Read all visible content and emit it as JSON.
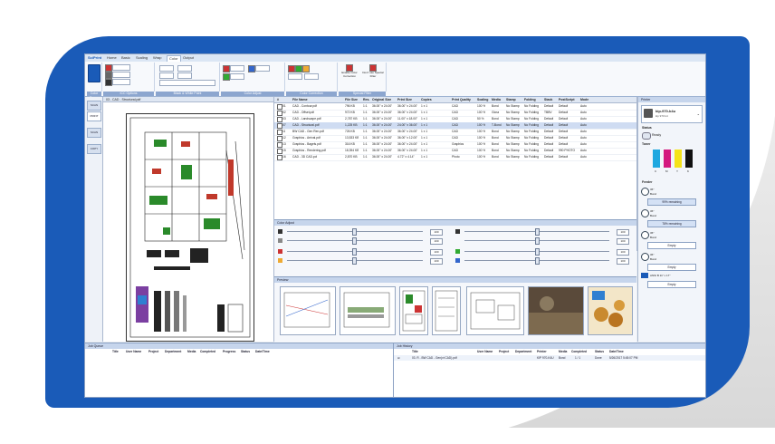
{
  "ribbon": {
    "tabs": [
      "SciPrint",
      "Home",
      "Basic",
      "Scaling",
      "Wrap",
      "Color",
      "Output"
    ],
    "groups": [
      "Color Space",
      "ICC Options",
      "Black & White Point",
      "Color Adjust",
      "Color Correction",
      "Special Filter"
    ],
    "actions": [
      "Enable Color Correction",
      "Don't use Special Filter"
    ]
  },
  "left_bar": {
    "items": [
      "SCAN",
      "PRINT",
      "SCAN",
      "COPY"
    ]
  },
  "doc_pane": {
    "title": "03 - CAD - Structural.pdf"
  },
  "list": {
    "headers": [
      "#",
      "File Name",
      "File Size",
      "Res.",
      "Original Size",
      "Print Size",
      "Copies",
      "Print Quality",
      "Scaling",
      "Media",
      "Stamp",
      "Folding",
      "Stack",
      "PostScript",
      "Mode"
    ],
    "rows": [
      [
        "01",
        "CAD - Contour.pdf",
        "796 KB",
        "1:1",
        "36.00\" x 24.00\"",
        "36.00\" x 24.00\"",
        "1 x 1",
        "CAD",
        "100 %",
        "Bond",
        "No Stamp",
        "No Folding",
        "Default",
        "Default",
        "Auto"
      ],
      [
        "02",
        "CAD - Offset.pdf",
        "972 KB",
        "1:1",
        "36.00\" x 24.00\"",
        "36.00\" x 24.00\"",
        "1 x 1",
        "CAD",
        "100 %",
        "Gloss",
        "No Stamp",
        "No Folding",
        "TBBV",
        "Default",
        "Auto"
      ],
      [
        "03",
        "CAD - Landscape.pdf",
        "2,787 KB",
        "1:1",
        "36.00\" x 24.00\"",
        "11.00\" x 18.00\"",
        "1 x 1",
        "CAD",
        "50 %",
        "Bond",
        "No Stamp",
        "No Folding",
        "Default",
        "Default",
        "Auto"
      ],
      [
        "07",
        "CAD - Structural.pdf",
        "1,225 KB",
        "1:1",
        "36.00\" x 24.00\"",
        "24.00\" x 36.00\"",
        "1 x 1",
        "CAD",
        "100 %",
        "T-Bond",
        "No Stamp",
        "No Folding",
        "Default",
        "Default",
        "Auto"
      ],
      [
        "11",
        "BW CAD - Gen Ren.pdf",
        "726 KB",
        "1:1",
        "36.00\" x 24.00\"",
        "36.00\" x 24.00\"",
        "1 x 1",
        "CAD",
        "100 %",
        "Bond",
        "No Stamp",
        "No Folding",
        "Default",
        "Default",
        "Auto"
      ],
      [
        "12",
        "Graphics - Arrival.pdf",
        "13,533 KB",
        "1:1",
        "36.00\" x 24.00\"",
        "36.00\" x 12.00\"",
        "1 x 1",
        "CAD",
        "100 %",
        "Bond",
        "No Stamp",
        "No Folding",
        "Default",
        "Default",
        "Auto"
      ],
      [
        "13",
        "Graphics - Bagels.pdf",
        "316 KB",
        "1:1",
        "36.00\" x 24.00\"",
        "36.00\" x 24.00\"",
        "1 x 1",
        "Graphics",
        "100 %",
        "Bond",
        "No Stamp",
        "No Folding",
        "Default",
        "Default",
        "Auto"
      ],
      [
        "15",
        "Graphics - Rendering.pdf",
        "18,394 KB",
        "1:1",
        "36.00\" x 24.00\"",
        "36.00\" x 24.00\"",
        "1 x 1",
        "CAD",
        "100 %",
        "Bond",
        "No Stamp",
        "No Folding",
        "Default",
        "990 PHOTO",
        "Auto"
      ],
      [
        "16",
        "CAD - 3D CAD.pdf",
        "2,870 KB",
        "1:1",
        "36.00\" x 24.00\"",
        "4.72\" x 4.14\"",
        "1 x 1",
        "Photo",
        "100 %",
        "Bond",
        "No Stamp",
        "No Folding",
        "Default",
        "Default",
        "Auto"
      ]
    ]
  },
  "color_adjust": {
    "title": "Color Adjust",
    "values": [
      "100",
      "100",
      "100",
      "100",
      "100",
      "100",
      "100",
      "100"
    ]
  },
  "preview": {
    "title": "Preview"
  },
  "right_pane": {
    "title": "Printer",
    "printer_name": "kip-970-k4u",
    "printer_sub": "kip 970 k4",
    "status_label": "Status",
    "status_value": "Ready",
    "toner_label": "Toner",
    "toner_letters": [
      "C",
      "M",
      "Y",
      "K"
    ],
    "feeder_label": "Feeder",
    "rolls": [
      {
        "size": "36\"",
        "media": "Bond",
        "state": "99% remaining"
      },
      {
        "size": "36\"",
        "media": "Bond",
        "state": "78% remaining"
      },
      {
        "size": "36\"",
        "media": "Bond",
        "state": "Empty"
      },
      {
        "size": "36\"",
        "media": "Bond",
        "state": "Empty"
      }
    ],
    "sheet": "ANSI B 11\" x 17\"",
    "sheet_state": "Empty"
  },
  "job_queue": {
    "title": "Job Queue",
    "headers": [
      "Title",
      "User Name",
      "Project",
      "Department",
      "Media",
      "Completed",
      "Progress",
      "Status",
      "Date/Time"
    ]
  },
  "job_history": {
    "title": "Job History",
    "headers": [
      "Title",
      "User Name",
      "Project",
      "Department",
      "Printer",
      "Media",
      "Completed",
      "Status",
      "Date/Time"
    ],
    "row": [
      "03. R - BW CAD - Gen(vt CAD).pdf",
      "KIP 970-K4U",
      "Bond",
      "1 / 1",
      "Done",
      "5/26/2017 5:45:07 PM"
    ]
  }
}
